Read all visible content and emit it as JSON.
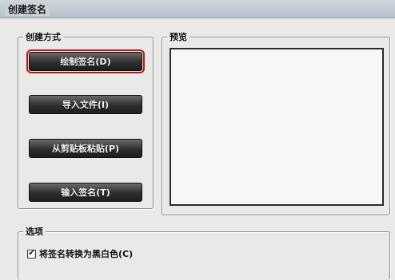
{
  "window": {
    "title": "创建签名"
  },
  "create_method": {
    "legend": "创建方式",
    "buttons": [
      {
        "label": "绘制签名(D)"
      },
      {
        "label": "导入文件(I)"
      },
      {
        "label": "从剪贴板粘贴(P)"
      },
      {
        "label": "输入签名(T)"
      }
    ]
  },
  "preview": {
    "legend": "预览"
  },
  "options": {
    "legend": "选项",
    "convert_bw_label": "将签名转换为黑白色(C)",
    "convert_bw_checked": true
  }
}
